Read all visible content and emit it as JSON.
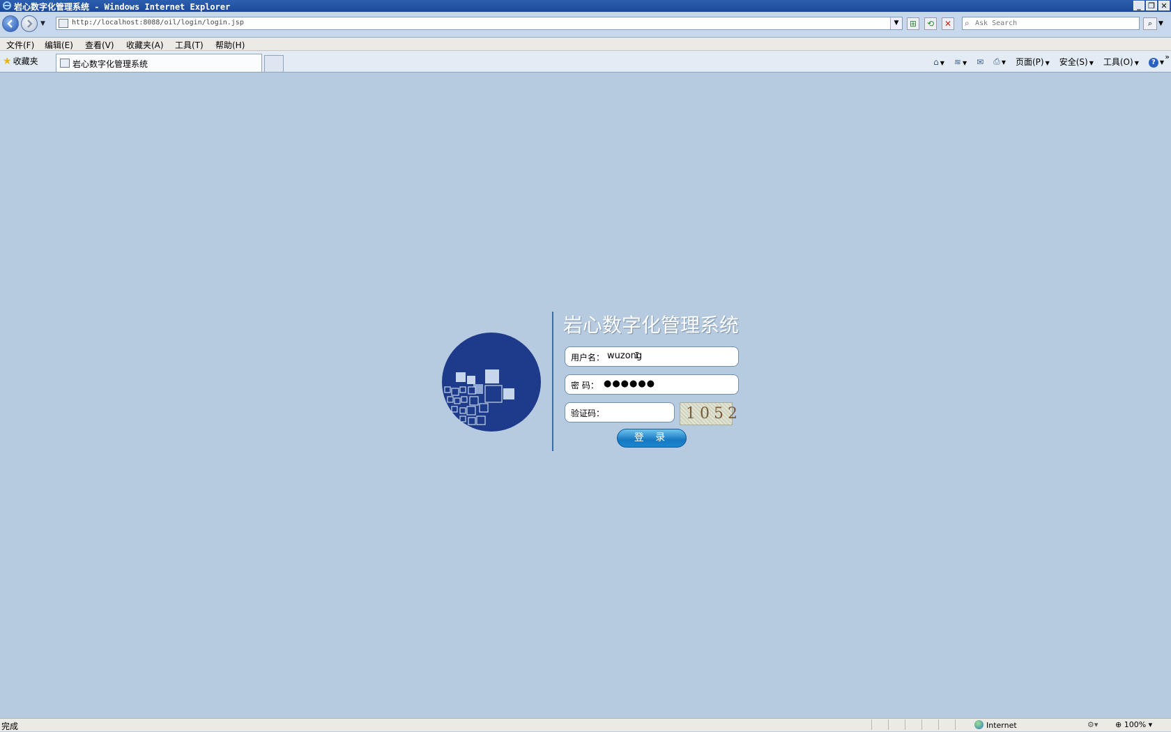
{
  "window": {
    "title": "岩心数字化管理系统 - Windows Internet Explorer",
    "controls": [
      "_",
      "❐",
      "✕"
    ]
  },
  "address": {
    "url": "http://localhost:8088/oil/login/login.jsp",
    "search_placeholder": "Ask Search"
  },
  "menu": {
    "items": [
      "文件(F)",
      "编辑(E)",
      "查看(V)",
      "收藏夹(A)",
      "工具(T)",
      "帮助(H)"
    ]
  },
  "favbar": {
    "favorites_label": "收藏夹",
    "tab_title": "岩心数字化管理系统",
    "commands": {
      "page": "页面(P)",
      "safety": "安全(S)",
      "tools": "工具(O)"
    }
  },
  "login": {
    "system_title": "岩心数字化管理系统",
    "username_label": "用户名：",
    "username_value": "wuzong",
    "password_label": "密  码：",
    "password_value": "●●●●●●",
    "captcha_label": "验证码：",
    "captcha_code": "1052",
    "login_button": "登 录"
  },
  "status": {
    "text": "完成",
    "zone": "Internet",
    "zoom": "100%"
  },
  "colors": {
    "page_background": "#b7cbe0",
    "logo_blue": "#1e3a8a",
    "button_blue": "#1678c2"
  }
}
